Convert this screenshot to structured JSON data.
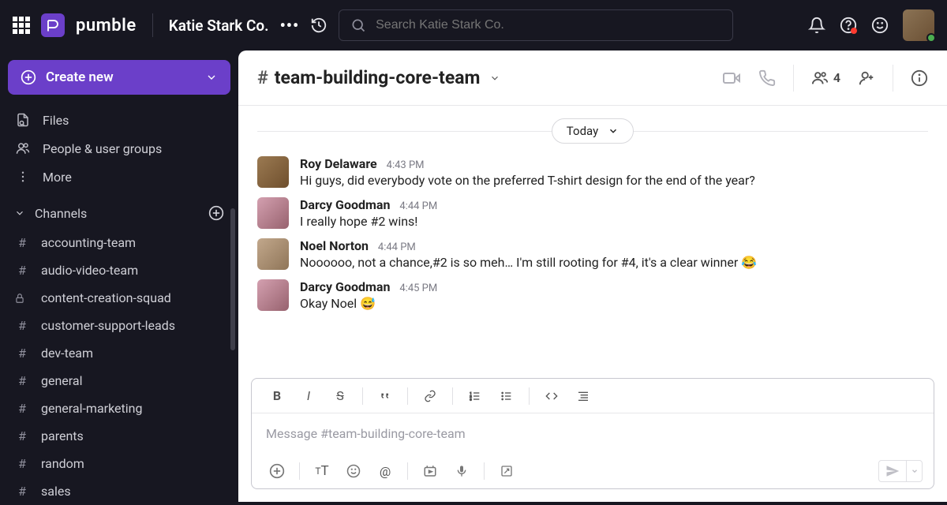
{
  "top": {
    "app_name": "pumble",
    "workspace": "Katie Stark Co.",
    "search_placeholder": "Search Katie Stark Co."
  },
  "sidebar": {
    "create_label": "Create new",
    "nav": {
      "files": "Files",
      "people": "People & user groups",
      "more": "More"
    },
    "section_channels": "Channels",
    "channels": [
      {
        "name": "accounting-team",
        "private": false
      },
      {
        "name": "audio-video-team",
        "private": false
      },
      {
        "name": "content-creation-squad",
        "private": true
      },
      {
        "name": "customer-support-leads",
        "private": false
      },
      {
        "name": "dev-team",
        "private": false
      },
      {
        "name": "general",
        "private": false
      },
      {
        "name": "general-marketing",
        "private": false
      },
      {
        "name": "parents",
        "private": false
      },
      {
        "name": "random",
        "private": false
      },
      {
        "name": "sales",
        "private": false
      }
    ]
  },
  "channel": {
    "name": "team-building-core-team",
    "member_count": "4",
    "date_divider": "Today",
    "messages": [
      {
        "author": "Roy Delaware",
        "time": "4:43 PM",
        "text": "Hi guys, did everybody vote on the preferred T-shirt design for the end of the year?",
        "avatar": "roy"
      },
      {
        "author": "Darcy Goodman",
        "time": "4:44 PM",
        "text": "I really hope #2 wins!",
        "avatar": "darcy"
      },
      {
        "author": "Noel Norton",
        "time": "4:44 PM",
        "text": "Noooooo, not a chance,#2 is so meh… I'm still rooting for #4, it's a clear winner 😂",
        "avatar": "noel"
      },
      {
        "author": "Darcy Goodman",
        "time": "4:45 PM",
        "text": "Okay Noel 😅",
        "avatar": "darcy"
      }
    ],
    "composer_placeholder": "Message #team-building-core-team"
  }
}
